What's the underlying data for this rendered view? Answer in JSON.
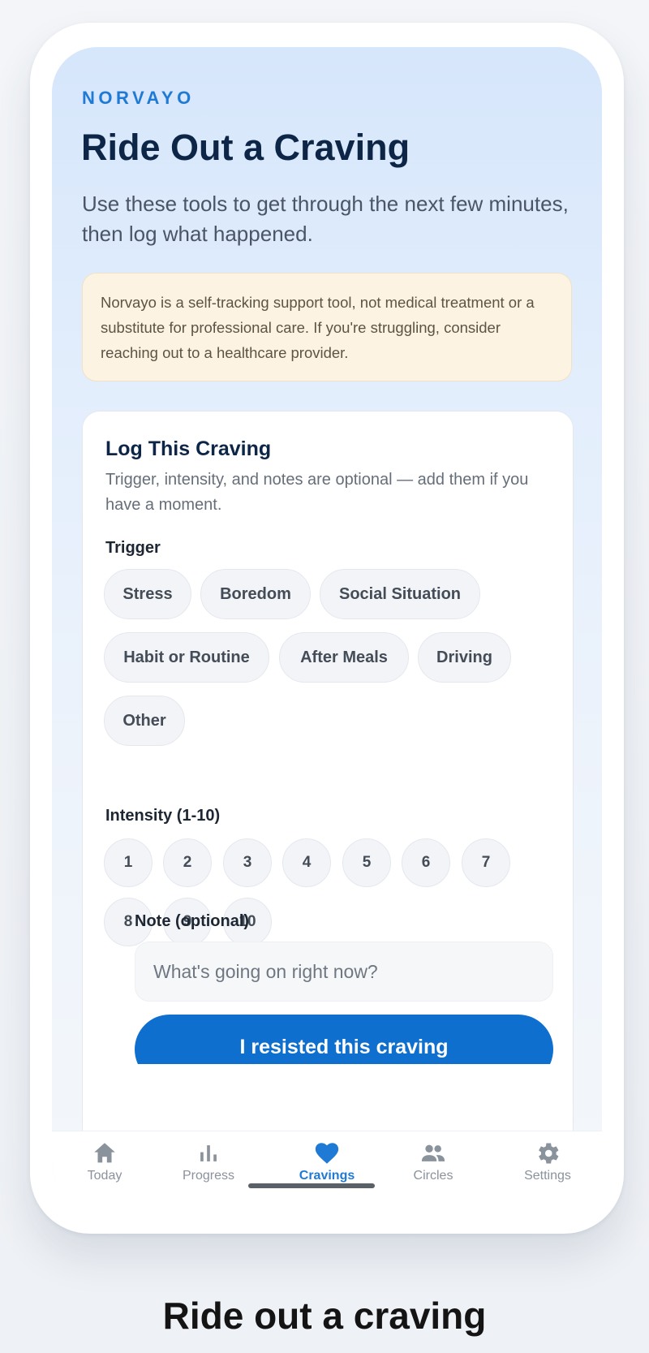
{
  "app": {
    "brand": "NORVAYO"
  },
  "header": {
    "title": "Ride Out a Craving",
    "subtitle": "Use these tools to get through the next few minutes, then log what happened."
  },
  "disclaimer": "Norvayo is a self-tracking support tool, not medical treatment or a substitute for professional care. If you're struggling, consider reaching out to a healthcare provider.",
  "log_card": {
    "title": "Log This Craving",
    "help": "Trigger, intensity, and notes are optional — add them if you have a moment.",
    "trigger_label": "Trigger",
    "triggers": [
      "Stress",
      "Boredom",
      "Social Situation",
      "Habit or Routine",
      "After Meals",
      "Driving",
      "Other"
    ],
    "intensity_label": "Intensity (1-10)",
    "intensity_values": [
      "1",
      "2",
      "3",
      "4",
      "5",
      "6",
      "7",
      "8",
      "9",
      "10"
    ],
    "note_label": "Note (optional)",
    "note_placeholder": "What's going on right now?",
    "note_value": "",
    "submit_label": "I resisted this craving"
  },
  "tabbar": {
    "items": [
      {
        "label": "Today",
        "icon": "home-icon",
        "active": false
      },
      {
        "label": "Progress",
        "icon": "bar-chart-icon",
        "active": false
      },
      {
        "label": "Cravings",
        "icon": "heart-icon",
        "active": true
      },
      {
        "label": "Circles",
        "icon": "people-icon",
        "active": false
      },
      {
        "label": "Settings",
        "icon": "gear-icon",
        "active": false
      }
    ]
  },
  "colors": {
    "accent": "#1f7ad6",
    "primary_button": "#0f6fcf",
    "title_text": "#0d2546",
    "disclaimer_bg": "#fdf3e2"
  },
  "caption": "Ride out a craving"
}
